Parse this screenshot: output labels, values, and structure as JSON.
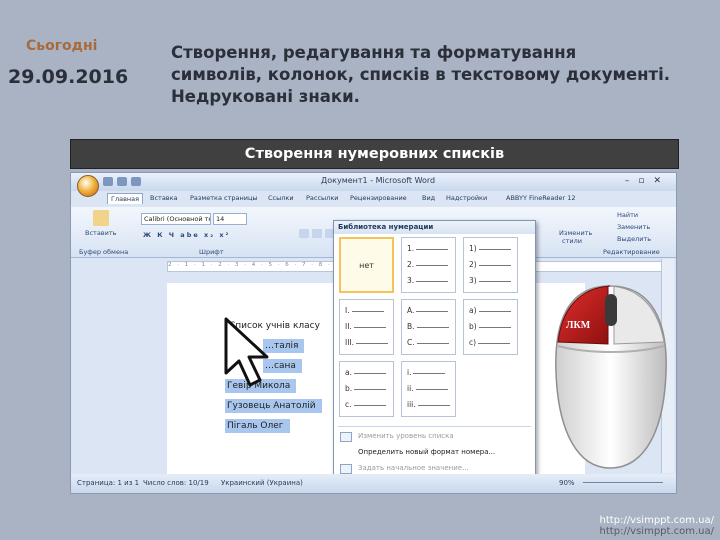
{
  "header": {
    "today_label": "Сьогодні",
    "date": "29.09.2016",
    "title": "Створення, редагування та форматування\nсимволів, колонок, списків в текстовому документі.\nНедруковані знаки."
  },
  "section_band": "Створення нумеровних списків",
  "word": {
    "doc_title": "Документ1 - Microsoft Word",
    "tabs": [
      "Главная",
      "Вставка",
      "Разметка страницы",
      "Ссылки",
      "Рассылки",
      "Рецензирование",
      "Вид",
      "Надстройки",
      "ABBYY FineReader 12"
    ],
    "ribbon": {
      "paste_label": "Вставить",
      "clipboard_group": "Буфер обмена",
      "font_name": "Calibri (Основной те",
      "font_size": "14",
      "font_group": "Шрифт",
      "find_label": "Найти",
      "replace_label": "Заменить",
      "select_label": "Выделить",
      "styles_label": "Изменить стили",
      "edit_group": "Редактирование",
      "format_row": "Ж К Ч abe x₂ x²"
    },
    "ruler_text": "2 · 1 · 1 · 2 · 3 · 4 · 5 · 6 · 7 · 8 · 9 · 10 · 11 · 12 · 13 · 14 · 15 · 16 · 17",
    "document": {
      "list_header": "Список учнів класу",
      "items": [
        "…талія",
        "…сана",
        "Гевір Микола",
        "Гузовець Анатолій",
        "Пігаль Олег"
      ]
    },
    "gallery": {
      "header": "Библиотека нумерации",
      "none_label": "нет",
      "formats": [
        [
          "1.",
          "2.",
          "3."
        ],
        [
          "1)",
          "2)",
          "3)"
        ],
        [
          "I.",
          "II.",
          "III."
        ],
        [
          "A.",
          "B.",
          "C."
        ],
        [
          "a)",
          "b)",
          "c)"
        ],
        [
          "a.",
          "b.",
          "c."
        ],
        [
          "i.",
          "ii.",
          "iii."
        ]
      ],
      "menu": [
        {
          "label": "Изменить уровень списка",
          "enabled": false
        },
        {
          "label": "Определить новый формат номера...",
          "enabled": true
        },
        {
          "label": "Задать начальное значение...",
          "enabled": false
        }
      ]
    },
    "status": {
      "page": "Страница: 1 из 1",
      "words": "Число слов: 10/19",
      "language": "Украинский (Украина)",
      "zoom": "90%"
    }
  },
  "mouse_label": "ЛКМ",
  "footer": {
    "url1": "http://vsimppt.com.ua/",
    "url2": "http://vsimppt.com.ua/"
  },
  "colors": {
    "background": "#a9b3c4",
    "band": "#404040",
    "accent_date": "#a96a3a",
    "selection": "#a9c7ee"
  }
}
